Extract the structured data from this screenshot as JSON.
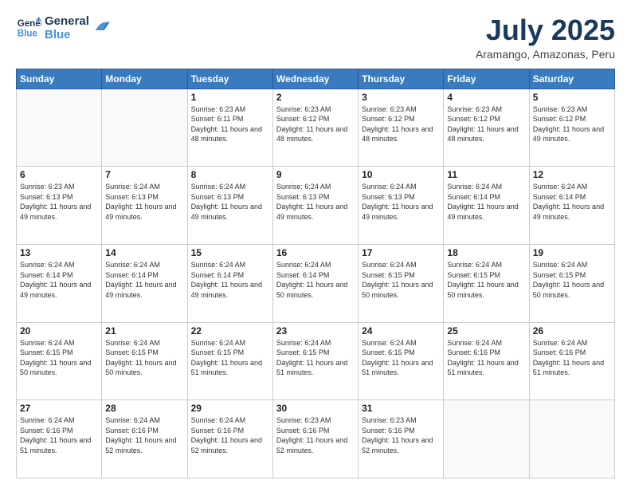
{
  "logo": {
    "line1": "General",
    "line2": "Blue"
  },
  "header": {
    "month": "July 2025",
    "location": "Aramango, Amazonas, Peru"
  },
  "weekdays": [
    "Sunday",
    "Monday",
    "Tuesday",
    "Wednesday",
    "Thursday",
    "Friday",
    "Saturday"
  ],
  "weeks": [
    [
      {
        "day": "",
        "info": ""
      },
      {
        "day": "",
        "info": ""
      },
      {
        "day": "1",
        "info": "Sunrise: 6:23 AM\nSunset: 6:11 PM\nDaylight: 11 hours and 48 minutes."
      },
      {
        "day": "2",
        "info": "Sunrise: 6:23 AM\nSunset: 6:12 PM\nDaylight: 11 hours and 48 minutes."
      },
      {
        "day": "3",
        "info": "Sunrise: 6:23 AM\nSunset: 6:12 PM\nDaylight: 11 hours and 48 minutes."
      },
      {
        "day": "4",
        "info": "Sunrise: 6:23 AM\nSunset: 6:12 PM\nDaylight: 11 hours and 48 minutes."
      },
      {
        "day": "5",
        "info": "Sunrise: 6:23 AM\nSunset: 6:12 PM\nDaylight: 11 hours and 49 minutes."
      }
    ],
    [
      {
        "day": "6",
        "info": "Sunrise: 6:23 AM\nSunset: 6:13 PM\nDaylight: 11 hours and 49 minutes."
      },
      {
        "day": "7",
        "info": "Sunrise: 6:24 AM\nSunset: 6:13 PM\nDaylight: 11 hours and 49 minutes."
      },
      {
        "day": "8",
        "info": "Sunrise: 6:24 AM\nSunset: 6:13 PM\nDaylight: 11 hours and 49 minutes."
      },
      {
        "day": "9",
        "info": "Sunrise: 6:24 AM\nSunset: 6:13 PM\nDaylight: 11 hours and 49 minutes."
      },
      {
        "day": "10",
        "info": "Sunrise: 6:24 AM\nSunset: 6:13 PM\nDaylight: 11 hours and 49 minutes."
      },
      {
        "day": "11",
        "info": "Sunrise: 6:24 AM\nSunset: 6:14 PM\nDaylight: 11 hours and 49 minutes."
      },
      {
        "day": "12",
        "info": "Sunrise: 6:24 AM\nSunset: 6:14 PM\nDaylight: 11 hours and 49 minutes."
      }
    ],
    [
      {
        "day": "13",
        "info": "Sunrise: 6:24 AM\nSunset: 6:14 PM\nDaylight: 11 hours and 49 minutes."
      },
      {
        "day": "14",
        "info": "Sunrise: 6:24 AM\nSunset: 6:14 PM\nDaylight: 11 hours and 49 minutes."
      },
      {
        "day": "15",
        "info": "Sunrise: 6:24 AM\nSunset: 6:14 PM\nDaylight: 11 hours and 49 minutes."
      },
      {
        "day": "16",
        "info": "Sunrise: 6:24 AM\nSunset: 6:14 PM\nDaylight: 11 hours and 50 minutes."
      },
      {
        "day": "17",
        "info": "Sunrise: 6:24 AM\nSunset: 6:15 PM\nDaylight: 11 hours and 50 minutes."
      },
      {
        "day": "18",
        "info": "Sunrise: 6:24 AM\nSunset: 6:15 PM\nDaylight: 11 hours and 50 minutes."
      },
      {
        "day": "19",
        "info": "Sunrise: 6:24 AM\nSunset: 6:15 PM\nDaylight: 11 hours and 50 minutes."
      }
    ],
    [
      {
        "day": "20",
        "info": "Sunrise: 6:24 AM\nSunset: 6:15 PM\nDaylight: 11 hours and 50 minutes."
      },
      {
        "day": "21",
        "info": "Sunrise: 6:24 AM\nSunset: 6:15 PM\nDaylight: 11 hours and 50 minutes."
      },
      {
        "day": "22",
        "info": "Sunrise: 6:24 AM\nSunset: 6:15 PM\nDaylight: 11 hours and 51 minutes."
      },
      {
        "day": "23",
        "info": "Sunrise: 6:24 AM\nSunset: 6:15 PM\nDaylight: 11 hours and 51 minutes."
      },
      {
        "day": "24",
        "info": "Sunrise: 6:24 AM\nSunset: 6:15 PM\nDaylight: 11 hours and 51 minutes."
      },
      {
        "day": "25",
        "info": "Sunrise: 6:24 AM\nSunset: 6:16 PM\nDaylight: 11 hours and 51 minutes."
      },
      {
        "day": "26",
        "info": "Sunrise: 6:24 AM\nSunset: 6:16 PM\nDaylight: 11 hours and 51 minutes."
      }
    ],
    [
      {
        "day": "27",
        "info": "Sunrise: 6:24 AM\nSunset: 6:16 PM\nDaylight: 11 hours and 51 minutes."
      },
      {
        "day": "28",
        "info": "Sunrise: 6:24 AM\nSunset: 6:16 PM\nDaylight: 11 hours and 52 minutes."
      },
      {
        "day": "29",
        "info": "Sunrise: 6:24 AM\nSunset: 6:16 PM\nDaylight: 11 hours and 52 minutes."
      },
      {
        "day": "30",
        "info": "Sunrise: 6:23 AM\nSunset: 6:16 PM\nDaylight: 11 hours and 52 minutes."
      },
      {
        "day": "31",
        "info": "Sunrise: 6:23 AM\nSunset: 6:16 PM\nDaylight: 11 hours and 52 minutes."
      },
      {
        "day": "",
        "info": ""
      },
      {
        "day": "",
        "info": ""
      }
    ]
  ]
}
